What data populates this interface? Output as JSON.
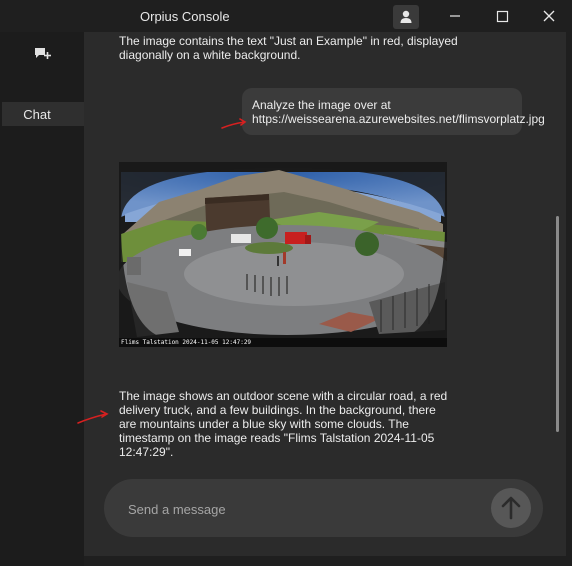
{
  "window": {
    "title": "Orpius Console",
    "controls": [
      "minimize-icon",
      "maximize-icon",
      "close-icon"
    ]
  },
  "header": {
    "profile_icon": "person-icon"
  },
  "sidebar": {
    "new_chat_icon": "new-chat-icon",
    "items": [
      {
        "label": "Chat",
        "selected": true
      }
    ]
  },
  "conversation": {
    "messages": [
      {
        "role": "assistant",
        "text": "The image contains the text \"Just an Example\" in red, displayed diagonally on a white background."
      },
      {
        "role": "user",
        "text": "Analyze the image over at https://weissearena.azurewebsites.net/flimsvorplatz.jpg"
      },
      {
        "role": "assistant",
        "type": "image",
        "image_caption": "Flims Talstation 2024-11-05 12:47:29"
      },
      {
        "role": "assistant",
        "text": "The image shows an outdoor scene with a circular road, a red delivery truck, and a few buildings. In the background, there are mountains under a blue sky with some clouds. The timestamp on the image reads \"Flims Talstation 2024-11-05 12:47:29\"."
      }
    ]
  },
  "composer": {
    "placeholder": "Send a message",
    "value": "",
    "send_icon": "arrow-up-icon"
  },
  "colors": {
    "background": "#1f1f1f",
    "main_panel": "#2b2b2b",
    "bubble": "#3b3b3b",
    "annotation": "#d62020"
  }
}
